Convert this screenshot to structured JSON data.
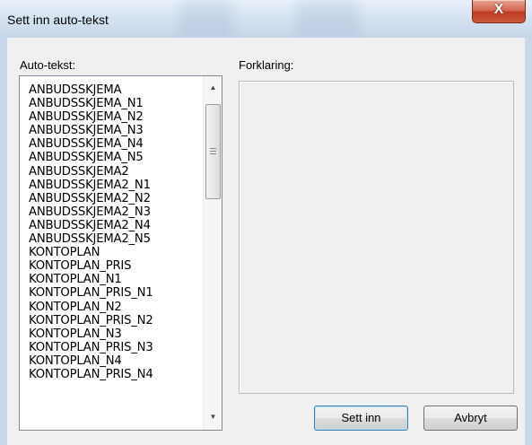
{
  "window": {
    "title": "Sett inn auto-tekst",
    "close_glyph": "X"
  },
  "autotext": {
    "label": "Auto-tekst:",
    "items": [
      "ANBUDSSKJEMA",
      "ANBUDSSKJEMA_N1",
      "ANBUDSSKJEMA_N2",
      "ANBUDSSKJEMA_N3",
      "ANBUDSSKJEMA_N4",
      "ANBUDSSKJEMA_N5",
      "ANBUDSSKJEMA2",
      "ANBUDSSKJEMA2_N1",
      "ANBUDSSKJEMA2_N2",
      "ANBUDSSKJEMA2_N3",
      "ANBUDSSKJEMA2_N4",
      "ANBUDSSKJEMA2_N5",
      "KONTOPLAN",
      "KONTOPLAN_PRIS",
      "KONTOPLAN_N1",
      "KONTOPLAN_PRIS_N1",
      "KONTOPLAN_N2",
      "KONTOPLAN_PRIS_N2",
      "KONTOPLAN_N3",
      "KONTOPLAN_PRIS_N3",
      "KONTOPLAN_N4",
      "KONTOPLAN_PRIS_N4"
    ],
    "scroll_up_glyph": "▲",
    "scroll_down_glyph": "▼"
  },
  "explanation": {
    "label": "Forklaring:",
    "text": ""
  },
  "buttons": {
    "insert": "Sett inn",
    "cancel": "Avbryt"
  }
}
